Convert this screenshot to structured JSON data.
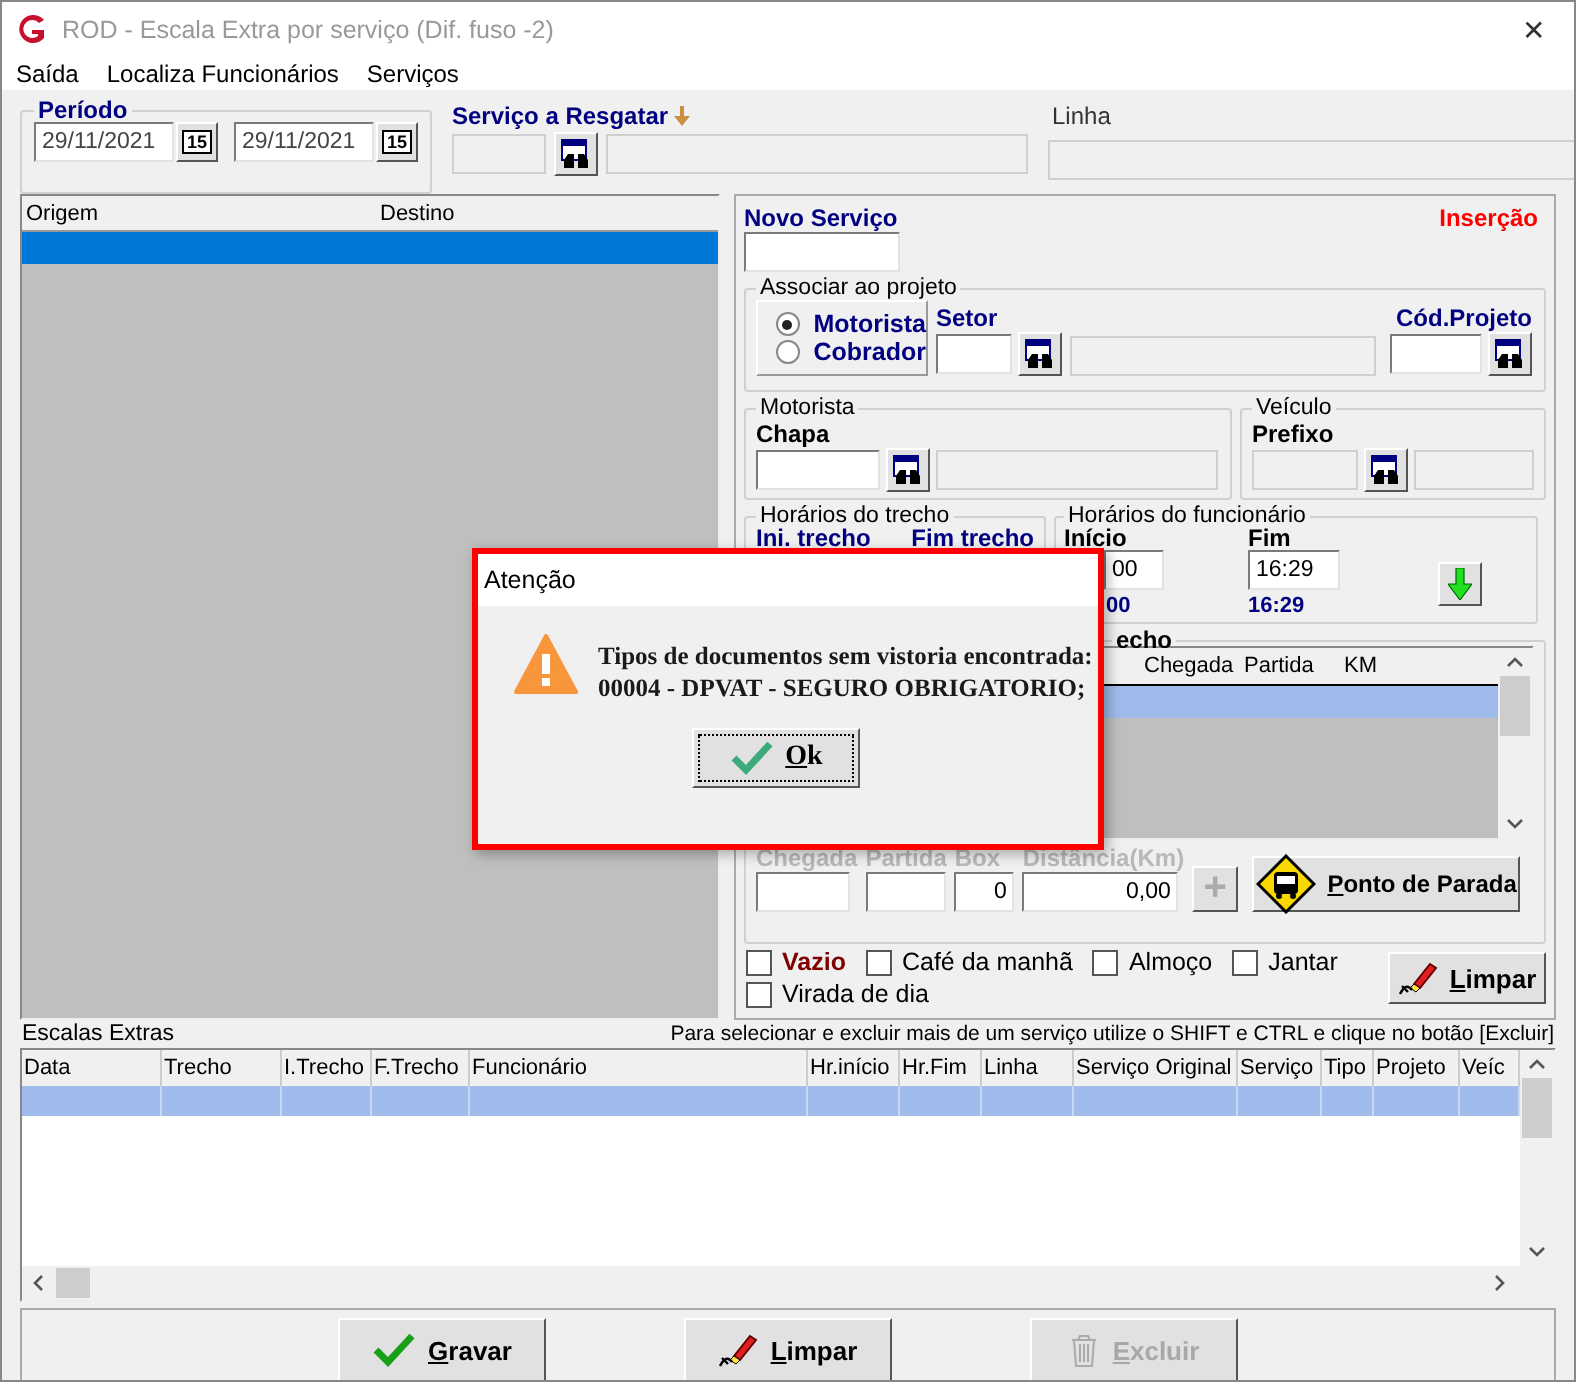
{
  "window": {
    "title": "ROD - Escala Extra por serviço (Dif. fuso -2)",
    "close": "✕"
  },
  "menu": [
    "Saída",
    "Localiza Funcionários",
    "Serviços"
  ],
  "periodo": {
    "label": "Período",
    "dates": [
      {
        "value": "29/11/2021",
        "calendar_day": "15"
      },
      {
        "value": "29/11/2021",
        "calendar_day": "15"
      }
    ]
  },
  "servico_resgatar": {
    "label": "Serviço a Resgatar"
  },
  "linha": {
    "label": "Linha"
  },
  "list": {
    "columns": [
      "Origem",
      "Destino"
    ],
    "rows": [
      {
        "selected": true
      }
    ]
  },
  "novo_servico": {
    "label": "Novo Serviço",
    "mode": "Inserção"
  },
  "associar": {
    "title": "Associar ao projeto",
    "options": [
      {
        "label": "Motorista",
        "selected": true
      },
      {
        "label": "Cobrador",
        "selected": false
      }
    ],
    "setor_label": "Setor",
    "cod_projeto_label": "Cód.Projeto"
  },
  "motorista": {
    "title": "Motorista",
    "chapa_label": "Chapa"
  },
  "veiculo": {
    "title": "Veículo",
    "prefixo_label": "Prefixo"
  },
  "horarios_trecho": {
    "title": "Horários do trecho",
    "columns": [
      "Ini. trecho",
      "Fim trecho"
    ]
  },
  "horarios_funcionario": {
    "title": "Horários do funcionário",
    "inicio_label": "Início",
    "fim_label": "Fim",
    "inicio_value": "00",
    "fim_value": "16:29",
    "inicio_reading": "00",
    "fim_reading": "16:29"
  },
  "pontos": {
    "title": "echo",
    "columns": [
      "Chegada",
      "Partida",
      "KM"
    ],
    "rows": [
      {
        "selected": true
      }
    ],
    "fields": [
      {
        "label": "Chegada"
      },
      {
        "label": "Partida"
      },
      {
        "label": "Box",
        "value": "0"
      },
      {
        "label": "Distância(Km)",
        "value": "0,00"
      }
    ],
    "add_button": {
      "label": "+",
      "disabled": true
    },
    "stop_button": "Ponto de Parada"
  },
  "options": [
    {
      "label": "Vazio",
      "checked": false,
      "kind": "emphasis"
    },
    {
      "label": "Café da manhã",
      "checked": false,
      "kind": "plain"
    },
    {
      "label": "Almoço",
      "checked": false,
      "kind": "plain"
    },
    {
      "label": "Jantar",
      "checked": false,
      "kind": "plain"
    },
    {
      "label": "Virada de dia",
      "checked": false,
      "kind": "plain"
    }
  ],
  "limpar_button": "Limpar",
  "escalas": {
    "title": "Escalas Extras",
    "hint": "Para selecionar e excluir mais de um serviço utilize o SHIFT e CTRL e clique no botão [Excluir]",
    "columns": [
      "Data",
      "Trecho",
      "I.Trecho",
      "F.Trecho",
      "Funcionário",
      "Hr.início",
      "Hr.Fim",
      "Linha",
      "Serviço Original",
      "Serviço",
      "Tipo",
      "Projeto",
      "Veíc"
    ],
    "rows": [
      {
        "selected": true
      }
    ]
  },
  "footer_buttons": [
    {
      "label": "Gravar",
      "disabled": false,
      "kind": "save"
    },
    {
      "label": "Limpar",
      "disabled": false,
      "kind": "clear"
    },
    {
      "label": "Excluir",
      "disabled": true,
      "kind": "delete"
    }
  ],
  "dialog": {
    "title": "Atenção",
    "message_lines": [
      "Tipos de documentos sem vistoria encontrada:",
      "00004 - DPVAT - SEGURO OBRIGATORIO;"
    ],
    "button": "Ok"
  }
}
